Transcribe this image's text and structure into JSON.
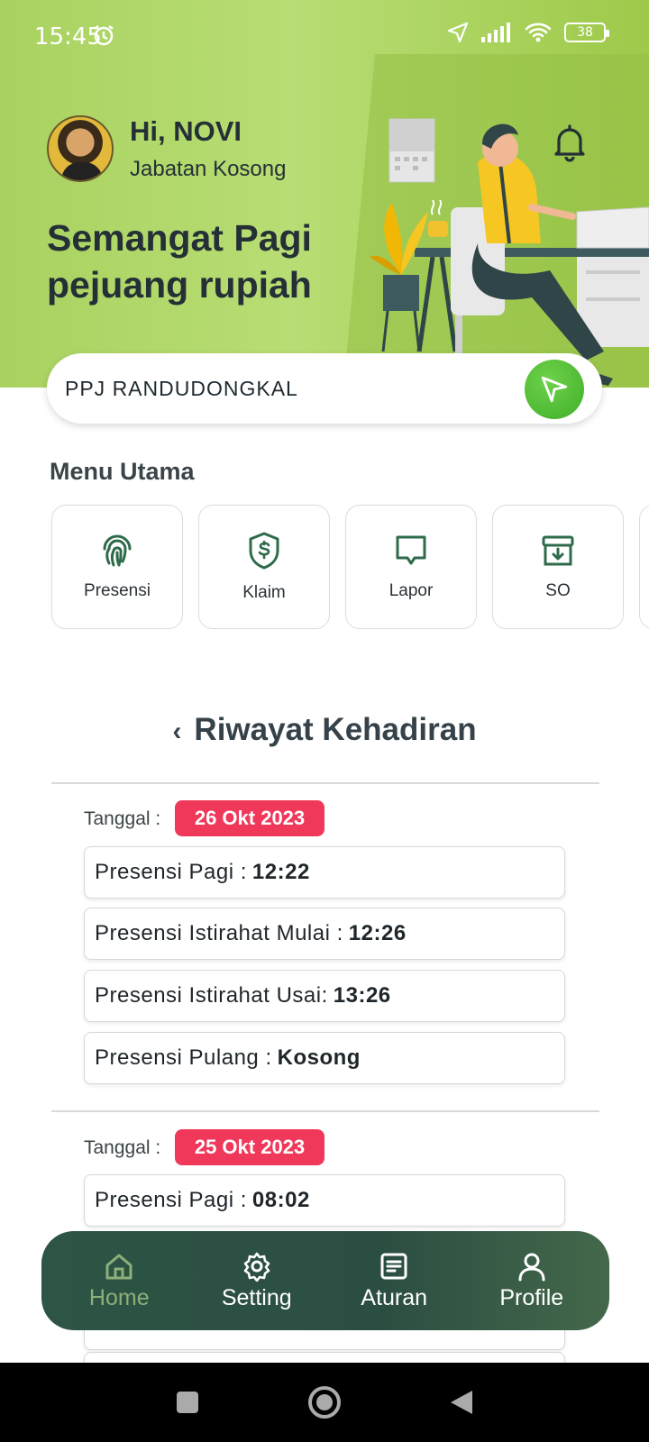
{
  "status": {
    "time": "15:45",
    "battery": "38"
  },
  "header": {
    "greeting": "Hi, NOVI",
    "jabatan": "Jabatan Kosong",
    "headline_line1": "Semangat Pagi",
    "headline_line2": "pejuang rupiah"
  },
  "search": {
    "value": "PPJ RANDUDONGKAL"
  },
  "menu": {
    "title": "Menu Utama",
    "items": [
      {
        "label": "Presensi",
        "icon": "fingerprint-icon"
      },
      {
        "label": "Klaim",
        "icon": "dollar-shield-icon"
      },
      {
        "label": "Lapor",
        "icon": "chat-icon"
      },
      {
        "label": "SO",
        "icon": "archive-icon"
      }
    ]
  },
  "riwayat": {
    "title": "Riwayat Kehadiran",
    "days": [
      {
        "label": "Tanggal :",
        "date": "26 Okt 2023",
        "entries": [
          {
            "label": "Presensi Pagi :",
            "value": "12:22"
          },
          {
            "label": "Presensi Istirahat Mulai :",
            "value": "12:26"
          },
          {
            "label": "Presensi Istirahat Usai:",
            "value": "13:26"
          },
          {
            "label": "Presensi Pulang :",
            "value": "Kosong"
          }
        ]
      },
      {
        "label": "Tanggal :",
        "date": "25 Okt 2023",
        "entries": [
          {
            "label": "Presensi Pagi :",
            "value": "08:02"
          }
        ]
      }
    ]
  },
  "nav": {
    "items": [
      {
        "label": "Home",
        "icon": "home-icon"
      },
      {
        "label": "Setting",
        "icon": "gear-icon"
      },
      {
        "label": "Aturan",
        "icon": "document-icon"
      },
      {
        "label": "Profile",
        "icon": "user-icon"
      }
    ]
  },
  "colors": {
    "header": "#a9d260",
    "badge": "#f0385a",
    "nav": "#2d5445",
    "accent": "#2e6b4a"
  }
}
